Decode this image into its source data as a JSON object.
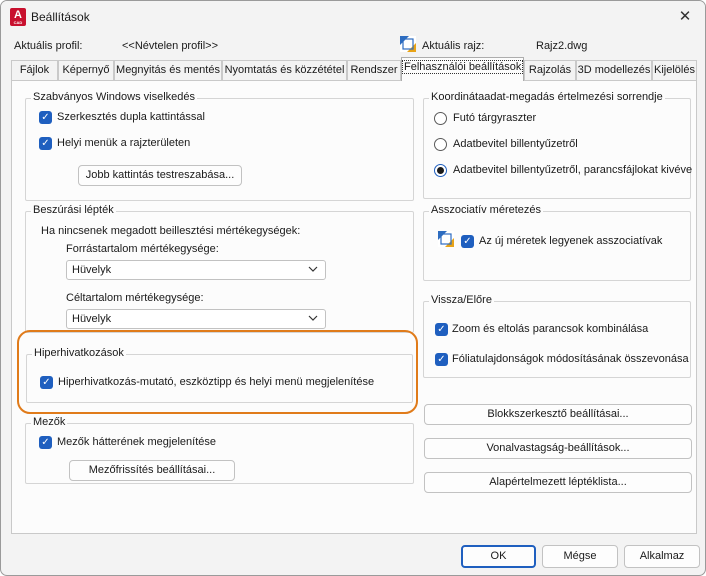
{
  "window": {
    "title": "Beállítások",
    "close_symbol": "✕"
  },
  "profile": {
    "current_profile_label": "Aktuális profil:",
    "current_profile_value": "<<Névtelen profil>>",
    "current_drawing_label": "Aktuális rajz:",
    "current_drawing_value": "Rajz2.dwg"
  },
  "tabs": [
    {
      "label": "Fájlok"
    },
    {
      "label": "Képernyő"
    },
    {
      "label": "Megnyitás és mentés"
    },
    {
      "label": "Nyomtatás és közzététel"
    },
    {
      "label": "Rendszer"
    },
    {
      "label": "Felhasználói beállítások"
    },
    {
      "label": "Rajzolás"
    },
    {
      "label": "3D modellezés"
    },
    {
      "label": "Kijelölés"
    }
  ],
  "windows_behavior": {
    "title": "Szabványos Windows viselkedés",
    "double_click_edit": "Szerkesztés dupla kattintással",
    "shortcut_menus": "Helyi menük a rajzterületen",
    "right_click_button": "Jobb kattintás testreszabása..."
  },
  "insertion_scale": {
    "title": "Beszúrási lépték",
    "description": "Ha nincsenek megadott beillesztési mértékegységek:",
    "source_label": "Forrástartalom mértékegysége:",
    "source_value": "Hüvelyk",
    "target_label": "Céltartalom mértékegysége:",
    "target_value": "Hüvelyk"
  },
  "hyperlink": {
    "title": "Hiperhivatkozások",
    "option": "Hiperhivatkozás-mutató, eszköztipp és helyi menü megjelenítése"
  },
  "fields": {
    "title": "Mezők",
    "option": "Mezők hátterének megjelenítése",
    "update_button": "Mezőfrissítés beállításai..."
  },
  "coordinate_priority": {
    "title": "Koordinátaadat-megadás értelmezési sorrendje",
    "options": [
      {
        "label": "Futó tárgyraszter",
        "selected": false
      },
      {
        "label": "Adatbevitel billentyűzetről",
        "selected": false
      },
      {
        "label": "Adatbevitel billentyűzetről, parancsfájlokat kivéve",
        "selected": true
      }
    ]
  },
  "associative_dim": {
    "title": "Asszociatív méretezés",
    "option": "Az új méretek legyenek asszociatívak"
  },
  "undo_redo": {
    "title": "Vissza/Előre",
    "zoom_pan": "Zoom és eltolás parancsok kombinálása",
    "layer_properties": "Fóliatulajdonságok módosításának összevonása"
  },
  "right_buttons": {
    "block_editor": "Blokkszerkesztő beállításai...",
    "lineweight": "Vonalvastagság-beállítások...",
    "scale_list": "Alapértelmezett léptéklista..."
  },
  "footer": {
    "ok": "OK",
    "cancel": "Mégse",
    "apply": "Alkalmaz"
  },
  "colors": {
    "accent": "#1f5fbf",
    "highlight": "#e07b1a",
    "brand": "#c8102e"
  }
}
